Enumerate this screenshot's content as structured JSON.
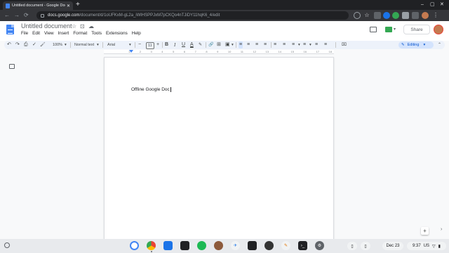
{
  "browser": {
    "tab_title": "Untitled document - Google Docs",
    "tab_close": "✕",
    "new_tab": "+",
    "url_host": "docs.google.com",
    "url_path": "/document/d/1oUFKxM-gL2a_iWlHSPPJxM7pCKQo4nTJiDY11hqK6_4/edit",
    "window_controls": [
      "–",
      "▢",
      "✕"
    ],
    "nav": [
      "←",
      "→",
      "⟳"
    ]
  },
  "docs": {
    "title": "Untitled document",
    "title_icons": [
      "☆",
      "⊡",
      "☁"
    ],
    "menus": [
      "File",
      "Edit",
      "View",
      "Insert",
      "Format",
      "Tools",
      "Extensions",
      "Help"
    ],
    "share_label": "Share",
    "meet_dropdown": "▾"
  },
  "toolbar": {
    "zoom": "100%",
    "style": "Normal text",
    "font": "Arial",
    "font_size": "11",
    "minus": "−",
    "plus": "+",
    "bold": "B",
    "italic": "I",
    "underline": "U",
    "text_color": "A",
    "editing": "Editing",
    "undo": "↶",
    "redo": "↷",
    "print": "⎙",
    "spell": "✓",
    "paint": "🖌",
    "dropdown": "▾",
    "link": "🔗",
    "comment": "⊞",
    "image": "▣",
    "align": "≡",
    "clear": "⌧",
    "collapse": "⌃"
  },
  "ruler": {
    "numbers": [
      "1",
      "2",
      "3",
      "4",
      "5",
      "6",
      "7",
      "8",
      "9",
      "10",
      "11",
      "12",
      "13",
      "14",
      "15",
      "16",
      "17",
      "18"
    ]
  },
  "document": {
    "body_text": "Offline Google Doc"
  },
  "shelf": {
    "date": "Dec 23",
    "time": "9:37",
    "locale": "US"
  }
}
